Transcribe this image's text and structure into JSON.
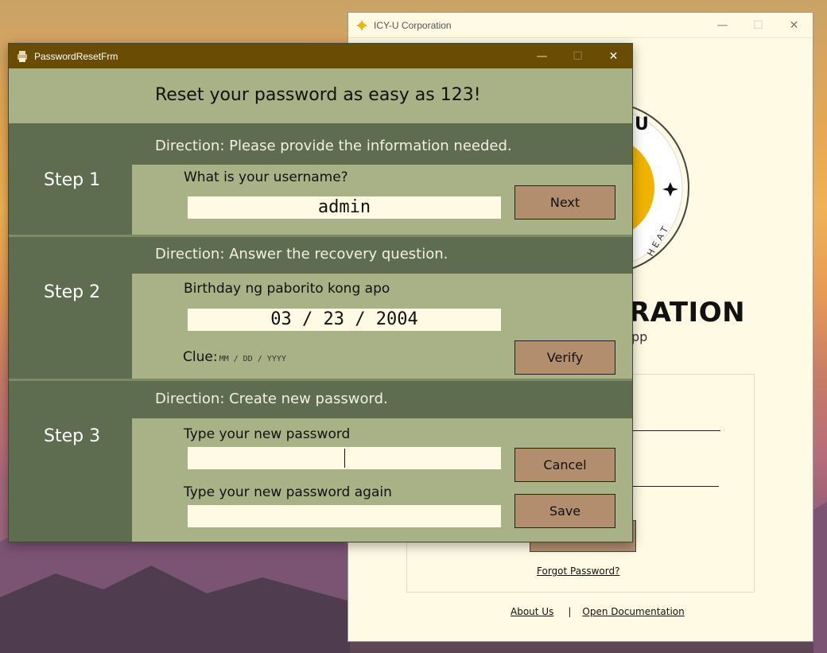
{
  "back_window": {
    "title": "ICY-U Corporation",
    "corp_text": "RATION",
    "corp_sub": "pp",
    "logo_letter": "U",
    "logo_ring_text": "HEAT",
    "forgot_password": "Forgot Password?",
    "about_us": "About Us",
    "separator": "|",
    "open_docs": "Open Documentation"
  },
  "front_window": {
    "title": "PasswordResetFrm",
    "header": "Reset your password as easy as 123!",
    "step1": {
      "label": "Step 1",
      "direction": "Direction: Please provide the information needed.",
      "question": "What is your username?",
      "value": "admin",
      "button": "Next"
    },
    "step2": {
      "label": "Step 2",
      "direction": "Direction: Answer the recovery question.",
      "question": "Birthday ng paborito kong apo",
      "value": "03 / 23 / 2004",
      "clue_label": "Clue:",
      "clue_format": "MM / DD / YYYY",
      "button": "Verify"
    },
    "step3": {
      "label": "Step 3",
      "direction": "Direction: Create new password.",
      "new_password_label": "Type your new password",
      "new_password_value": "",
      "confirm_label": "Type your new password again",
      "confirm_value": "",
      "cancel_button": "Cancel",
      "save_button": "Save"
    }
  },
  "window_controls": {
    "minimize": "—",
    "maximize": "☐",
    "close": "✕"
  },
  "colors": {
    "title_bar": "#6a4c05",
    "panel": "#a8b286",
    "dark_band": "#5e6c50",
    "field": "#fefae3",
    "button": "#b28e6e"
  }
}
